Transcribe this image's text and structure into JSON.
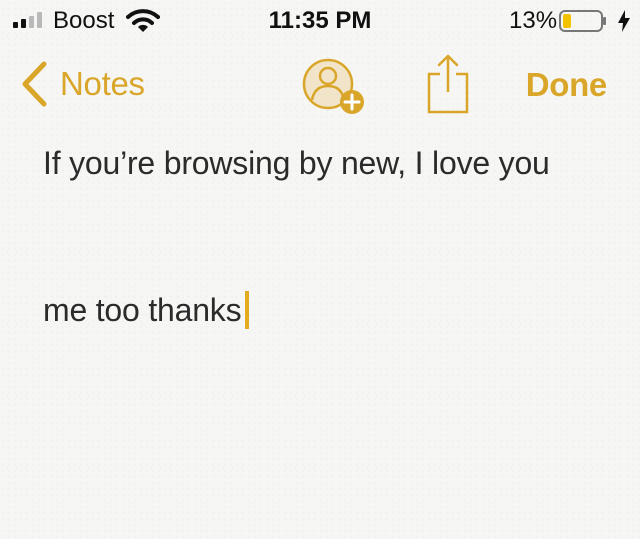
{
  "status_bar": {
    "carrier": "Boost",
    "time": "11:35 PM",
    "battery_percent": "13%",
    "battery_level": 0.13,
    "charging": true,
    "signal_bars": 2
  },
  "nav": {
    "back_label": "Notes",
    "done_label": "Done"
  },
  "note": {
    "line1": "If you’re browsing by new, I love you",
    "line2": "me too thanks"
  },
  "colors": {
    "accent": "#d9a62a",
    "caret": "#e3ab1f",
    "battery_fill": "#f2c200",
    "text": "#2b2b2b"
  },
  "icons": [
    "signal-icon",
    "wifi-icon",
    "battery-icon",
    "charging-bolt-icon",
    "chevron-left-icon",
    "add-person-icon",
    "share-icon"
  ]
}
